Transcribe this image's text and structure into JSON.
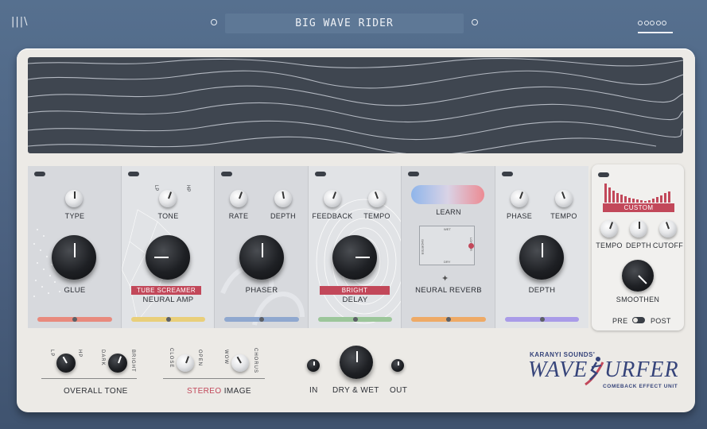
{
  "header": {
    "menu_icon": "menu-icon",
    "preset_name": "BIG WAVE RIDER",
    "nav_icon": "dots-icon"
  },
  "modules": [
    {
      "id": "neural-amp-left",
      "knobs": [
        "TYPE"
      ],
      "main_knob": "GLUE",
      "strip_color": "#e88a7d"
    },
    {
      "id": "neural-amp",
      "knobs": [
        "TONE"
      ],
      "tone_marks": {
        "left": "LP",
        "right": "HP"
      },
      "tag": "TUBE SCREAMER",
      "title": "NEURAL AMP",
      "strip_color": "#e9cf7a"
    },
    {
      "id": "phaser",
      "knobs": [
        "RATE",
        "DEPTH"
      ],
      "title": "PHASER",
      "strip_color": "#8fa8cf"
    },
    {
      "id": "delay",
      "knobs": [
        "FEEDBACK",
        "TEMPO"
      ],
      "tag": "BRIGHT",
      "title": "DELAY",
      "strip_color": "#9cc69a"
    },
    {
      "id": "neural-reverb",
      "learn": "LEARN",
      "pad_labels": {
        "top": "WET",
        "bottom": "DRY",
        "left": "SHORTER",
        "right": "LONGER"
      },
      "title": "NEURAL REVERB",
      "strip_color": "#eeaa66"
    },
    {
      "id": "modulation",
      "knobs": [
        "PHASE",
        "TEMPO"
      ],
      "title": "DEPTH",
      "strip_color": "#a99be8"
    }
  ],
  "side_panel": {
    "mode_tag": "CUSTOM",
    "knobs": [
      "TEMPO",
      "DEPTH",
      "CUTOFF"
    ],
    "main_knob": "SMOOTHEN",
    "toggle_left": "PRE",
    "toggle_right": "POST"
  },
  "bottom": {
    "overall_tone": "OVERALL TONE",
    "tone_marks": [
      "LP",
      "HP",
      "DARK",
      "BRIGHT"
    ],
    "stereo_prefix": "STEREO",
    "stereo_suffix": " IMAGE",
    "stereo_marks": [
      "CLOSE",
      "OPEN",
      "WOW",
      "CHORUS"
    ],
    "in": "IN",
    "dry_wet": "DRY & WET",
    "out": "OUT"
  },
  "logo": {
    "brand": "KARANYI SOUNDS'",
    "name_part1": "WAVE",
    "name_part2": "URFER",
    "sub": "COMEBACK EFFECT UNIT"
  },
  "colors": {
    "accent": "#c2485a",
    "logo": "#36447a",
    "display": "#3f4650"
  }
}
